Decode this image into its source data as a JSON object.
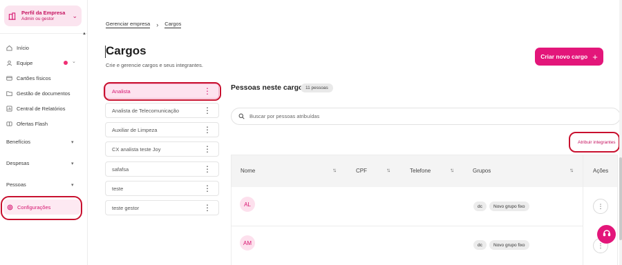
{
  "sidebar": {
    "company_name": "Perfil da Empresa",
    "company_role": "Admin ou gestor",
    "items": [
      {
        "label": "Início"
      },
      {
        "label": "Equipe"
      },
      {
        "label": "Cartões físicos"
      },
      {
        "label": "Gestão de documentos"
      },
      {
        "label": "Central de Relatórios"
      },
      {
        "label": "Ofertas Flash"
      }
    ],
    "sections": [
      {
        "label": "Benefícios"
      },
      {
        "label": "Despesas"
      },
      {
        "label": "Pessoas"
      }
    ],
    "active_item": "Configurações"
  },
  "breadcrumb": {
    "parent": "Gerenciar empresa",
    "current": "Cargos"
  },
  "page": {
    "title": "Cargos",
    "subtitle": "Crie e gerencie cargos e seus integrantes.",
    "create_button": "Criar novo cargo"
  },
  "roles": [
    {
      "name": "Analista"
    },
    {
      "name": "Analista de Telecomunicação"
    },
    {
      "name": "Auxiliar de Limpeza"
    },
    {
      "name": "CX analista teste Joy"
    },
    {
      "name": "safafsa"
    },
    {
      "name": "teste"
    },
    {
      "name": "teste gestor"
    }
  ],
  "people_panel": {
    "title": "Pessoas neste cargo",
    "count": "11 pessoas",
    "search_placeholder": "Buscar por pessoas atribuídas",
    "assign_link": "Atribuir integrantes",
    "columns": {
      "name": "Nome",
      "cpf": "CPF",
      "phone": "Telefone",
      "groups": "Grupos",
      "actions": "Ações"
    },
    "rows": [
      {
        "initials": "AL",
        "groups": [
          "dc",
          "Novo grupo fixo"
        ]
      },
      {
        "initials": "AM",
        "groups": [
          "dc",
          "Novo grupo fixo"
        ]
      }
    ]
  },
  "colors": {
    "accent": "#e3167a",
    "annotation": "#c8102e"
  }
}
